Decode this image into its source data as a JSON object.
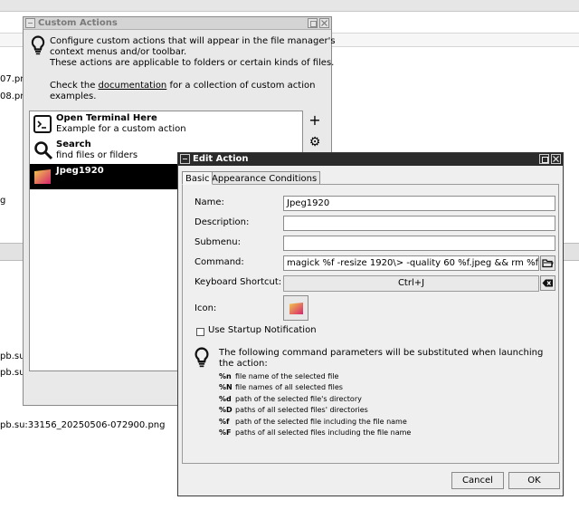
{
  "background": {
    "file_items": [
      "07.pn",
      "08.pn",
      "g",
      "pb.su",
      "pb.su",
      "pb.su:33156_20250506-072900.png"
    ]
  },
  "custom_actions": {
    "title": "Custom Actions",
    "intro_lines": [
      "Configure custom actions that will appear in the file manager's",
      "context menus and/or toolbar.",
      "These actions are applicable to folders or certain kinds of files."
    ],
    "doc_prefix": "Check the ",
    "doc_link": "documentation",
    "doc_suffix": " for a collection of custom action",
    "doc_line2": "examples.",
    "actions": [
      {
        "title": "Open Terminal Here",
        "subtitle": "Example for a custom action",
        "icon": "terminal-icon"
      },
      {
        "title": "Search",
        "subtitle": "find files or filders",
        "icon": "search-icon"
      },
      {
        "title": "Jpeg1920",
        "subtitle": "",
        "icon": "image-icon"
      }
    ],
    "add_glyph": "+",
    "settings_glyph": "⚙"
  },
  "edit_action": {
    "title": "Edit Action",
    "tabs": [
      "Basic",
      "Appearance Conditions"
    ],
    "name_label": "Name:",
    "name_value": "Jpeg1920",
    "description_label": "Description:",
    "description_value": "",
    "submenu_label": "Submenu:",
    "submenu_value": "",
    "command_label": "Command:",
    "command_value": "magick %f -resize 1920\\> -quality 60 %f.jpeg && rm %f",
    "shortcut_label": "Keyboard Shortcut:",
    "shortcut_value": "Ctrl+J",
    "icon_label": "Icon:",
    "startup_label": "Use Startup Notification",
    "startup_checked": false,
    "params_intro": "The following command parameters will be substituted when launching the action:",
    "params": [
      {
        "code": "%n",
        "desc": "file name of the selected file"
      },
      {
        "code": "%N",
        "desc": "file names of all selected files"
      },
      {
        "code": "%d",
        "desc": "path of the selected file's directory"
      },
      {
        "code": "%D",
        "desc": "paths of all selected files' directories"
      },
      {
        "code": "%f",
        "desc": "path of the selected file including the file name"
      },
      {
        "code": "%F",
        "desc": "paths of all selected files including the file name"
      }
    ],
    "cancel_label": "Cancel",
    "ok_label": "OK"
  },
  "colors": {
    "selection": "#000000",
    "dialog_titlebar": "#2b2b2b",
    "icon_gradient_start": "#f2c94c",
    "icon_gradient_end": "#d6246e"
  }
}
